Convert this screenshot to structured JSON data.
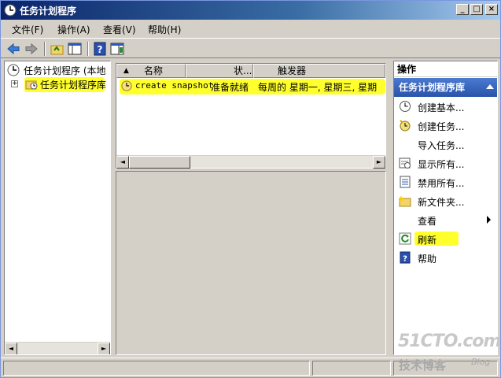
{
  "window": {
    "title": "任务计划程序"
  },
  "title_controls": {
    "minimize": "_",
    "maximize": "□",
    "close": "×"
  },
  "menu": [
    {
      "label": "文件(F)"
    },
    {
      "label": "操作(A)"
    },
    {
      "label": "查看(V)"
    },
    {
      "label": "帮助(H)"
    }
  ],
  "tree": {
    "root_label": "任务计划程序 (本地",
    "expander": "+",
    "library_label": "任务计划程序库"
  },
  "list": {
    "columns": [
      "名称",
      "状...",
      "触发器"
    ],
    "sort_indicator": "▲",
    "rows": [
      {
        "name": "create snapshot",
        "status": "准备就绪",
        "trigger": "每周的 星期一, 星期三, 星期"
      }
    ]
  },
  "scroll": {
    "left": "◄",
    "right": "►"
  },
  "actions": {
    "title": "操作",
    "group_label": "任务计划程序库",
    "items": [
      {
        "label": "创建基本..."
      },
      {
        "label": "创建任务..."
      },
      {
        "label": "导入任务..."
      },
      {
        "label": "显示所有..."
      },
      {
        "label": "禁用所有..."
      },
      {
        "label": "新文件夹..."
      },
      {
        "label": "查看"
      },
      {
        "label": "刷新"
      },
      {
        "label": "帮助"
      }
    ]
  },
  "watermark": {
    "site": "51CTO.com",
    "sub": "技术博客",
    "blog": "Blog"
  },
  "colors": {
    "highlight": "#ffff2e",
    "title_blue": "#0a246a",
    "action_header": "#2954a9"
  }
}
